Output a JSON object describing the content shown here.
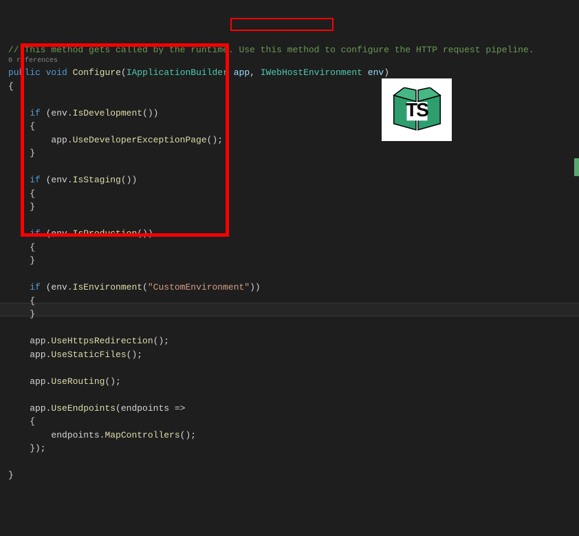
{
  "codelens": "0 references",
  "logo": {
    "text": "TS"
  },
  "lines": [
    {
      "tokens": [
        {
          "cls": "comment",
          "t": "// This method gets called by the runtime. Use this method to configure the HTTP request pipeline."
        }
      ]
    },
    {
      "codelens": true
    },
    {
      "tokens": [
        {
          "cls": "keyword",
          "t": "public"
        },
        {
          "cls": "plain",
          "t": " "
        },
        {
          "cls": "keyword",
          "t": "void"
        },
        {
          "cls": "plain",
          "t": " "
        },
        {
          "cls": "method",
          "t": "Configure"
        },
        {
          "cls": "plain",
          "t": "("
        },
        {
          "cls": "type",
          "t": "IApplicationBuilder"
        },
        {
          "cls": "plain",
          "t": " "
        },
        {
          "cls": "param",
          "t": "app"
        },
        {
          "cls": "plain",
          "t": ", "
        },
        {
          "cls": "type",
          "t": "IWebHostEnvironment"
        },
        {
          "cls": "plain",
          "t": " "
        },
        {
          "cls": "param",
          "t": "env"
        },
        {
          "cls": "plain",
          "t": ")"
        }
      ]
    },
    {
      "tokens": [
        {
          "cls": "plain",
          "t": "{"
        }
      ]
    },
    {
      "tokens": []
    },
    {
      "tokens": [
        {
          "cls": "plain",
          "t": "    "
        },
        {
          "cls": "keyword",
          "t": "if"
        },
        {
          "cls": "plain",
          "t": " (env."
        },
        {
          "cls": "method",
          "t": "IsDevelopment"
        },
        {
          "cls": "plain",
          "t": "())"
        }
      ]
    },
    {
      "tokens": [
        {
          "cls": "plain",
          "t": "    {"
        }
      ]
    },
    {
      "tokens": [
        {
          "cls": "plain",
          "t": "        app."
        },
        {
          "cls": "method",
          "t": "UseDeveloperExceptionPage"
        },
        {
          "cls": "plain",
          "t": "();"
        }
      ]
    },
    {
      "tokens": [
        {
          "cls": "plain",
          "t": "    }"
        }
      ]
    },
    {
      "tokens": []
    },
    {
      "tokens": [
        {
          "cls": "plain",
          "t": "    "
        },
        {
          "cls": "keyword",
          "t": "if"
        },
        {
          "cls": "plain",
          "t": " (env."
        },
        {
          "cls": "method",
          "t": "IsStaging"
        },
        {
          "cls": "plain",
          "t": "())"
        }
      ]
    },
    {
      "tokens": [
        {
          "cls": "plain",
          "t": "    {"
        }
      ]
    },
    {
      "tokens": [
        {
          "cls": "plain",
          "t": "    }"
        }
      ]
    },
    {
      "tokens": []
    },
    {
      "tokens": [
        {
          "cls": "plain",
          "t": "    "
        },
        {
          "cls": "keyword",
          "t": "if"
        },
        {
          "cls": "plain",
          "t": " (env."
        },
        {
          "cls": "method",
          "t": "IsProduction"
        },
        {
          "cls": "plain",
          "t": "())"
        }
      ]
    },
    {
      "tokens": [
        {
          "cls": "plain",
          "t": "    {"
        }
      ]
    },
    {
      "tokens": [
        {
          "cls": "plain",
          "t": "    }"
        }
      ]
    },
    {
      "tokens": []
    },
    {
      "tokens": [
        {
          "cls": "plain",
          "t": "    "
        },
        {
          "cls": "keyword",
          "t": "if"
        },
        {
          "cls": "plain",
          "t": " (env."
        },
        {
          "cls": "method",
          "t": "IsEnvironment"
        },
        {
          "cls": "plain",
          "t": "("
        },
        {
          "cls": "string",
          "t": "\"CustomEnvironment\""
        },
        {
          "cls": "plain",
          "t": "))"
        }
      ]
    },
    {
      "tokens": [
        {
          "cls": "plain",
          "t": "    {"
        }
      ]
    },
    {
      "tokens": [
        {
          "cls": "plain",
          "t": "    }"
        }
      ]
    },
    {
      "tokens": []
    },
    {
      "tokens": [
        {
          "cls": "plain",
          "t": "    app."
        },
        {
          "cls": "method",
          "t": "UseHttpsRedirection"
        },
        {
          "cls": "plain",
          "t": "();"
        }
      ]
    },
    {
      "tokens": [
        {
          "cls": "plain",
          "t": "    app."
        },
        {
          "cls": "method",
          "t": "UseStaticFiles"
        },
        {
          "cls": "plain",
          "t": "();"
        }
      ]
    },
    {
      "tokens": []
    },
    {
      "tokens": [
        {
          "cls": "plain",
          "t": "    app."
        },
        {
          "cls": "method",
          "t": "UseRouting"
        },
        {
          "cls": "plain",
          "t": "();"
        }
      ]
    },
    {
      "tokens": []
    },
    {
      "tokens": [
        {
          "cls": "plain",
          "t": "    app."
        },
        {
          "cls": "method",
          "t": "UseEndpoints"
        },
        {
          "cls": "plain",
          "t": "(endpoints =>"
        }
      ]
    },
    {
      "tokens": [
        {
          "cls": "plain",
          "t": "    {"
        }
      ]
    },
    {
      "tokens": [
        {
          "cls": "plain",
          "t": "        endpoints."
        },
        {
          "cls": "method",
          "t": "MapControllers"
        },
        {
          "cls": "plain",
          "t": "();"
        }
      ]
    },
    {
      "tokens": [
        {
          "cls": "plain",
          "t": "    });"
        }
      ]
    },
    {
      "tokens": []
    },
    {
      "tokens": [
        {
          "cls": "plain",
          "t": "}"
        }
      ]
    }
  ]
}
